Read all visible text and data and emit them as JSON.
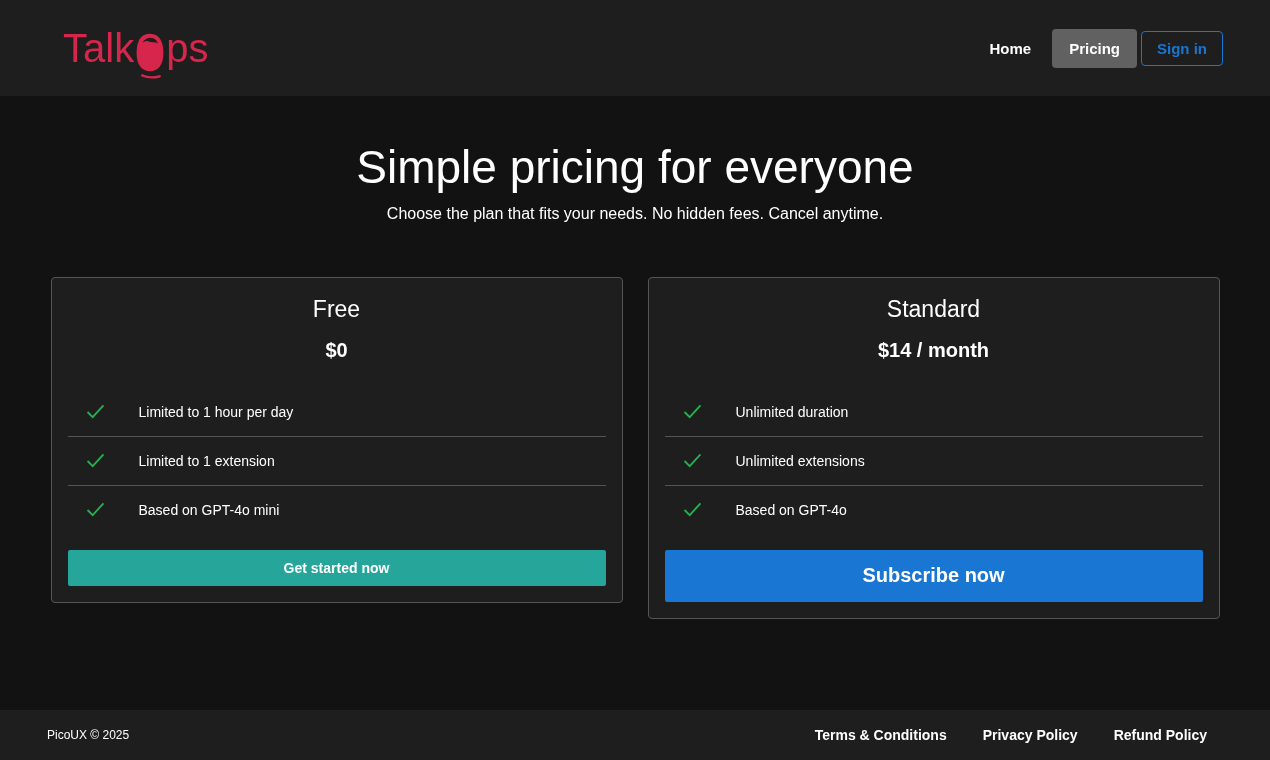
{
  "header": {
    "logo": {
      "before": "Talk",
      "after": "ps"
    },
    "nav": [
      {
        "label": "Home",
        "kind": "link",
        "selected": false
      },
      {
        "label": "Pricing",
        "kind": "link",
        "selected": true
      },
      {
        "label": "Sign in",
        "kind": "outline",
        "selected": false
      }
    ]
  },
  "hero": {
    "title": "Simple pricing for everyone",
    "subtitle": "Choose the plan that fits your needs. No hidden fees. Cancel anytime."
  },
  "plans": [
    {
      "name": "Free",
      "price": "$0",
      "features": [
        "Limited to 1 hour per day",
        "Limited to 1 extension",
        "Based on GPT-4o mini"
      ],
      "button": {
        "label": "Get started now",
        "kind": "teal"
      }
    },
    {
      "name": "Standard",
      "price": "$14 / month",
      "features": [
        "Unlimited duration",
        "Unlimited extensions",
        "Based on GPT-4o"
      ],
      "button": {
        "label": "Subscribe now",
        "kind": "primary"
      }
    }
  ],
  "footer": {
    "copyright": "PicoUX © 2025",
    "links": [
      "Terms & Conditions",
      "Privacy Policy",
      "Refund Policy"
    ]
  }
}
